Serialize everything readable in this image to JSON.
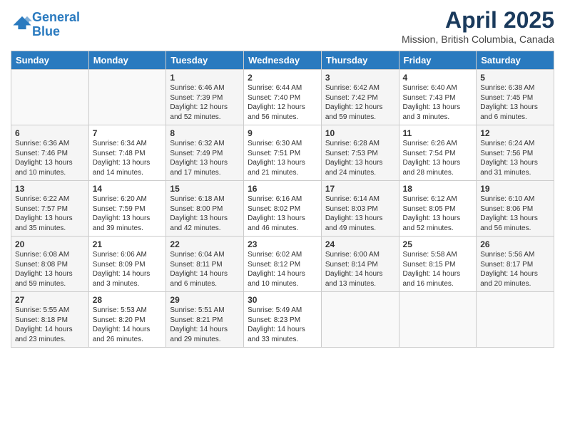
{
  "header": {
    "logo_line1": "General",
    "logo_line2": "Blue",
    "month_title": "April 2025",
    "subtitle": "Mission, British Columbia, Canada"
  },
  "weekdays": [
    "Sunday",
    "Monday",
    "Tuesday",
    "Wednesday",
    "Thursday",
    "Friday",
    "Saturday"
  ],
  "weeks": [
    [
      {
        "day": "",
        "sunrise": "",
        "sunset": "",
        "daylight": ""
      },
      {
        "day": "",
        "sunrise": "",
        "sunset": "",
        "daylight": ""
      },
      {
        "day": "1",
        "sunrise": "Sunrise: 6:46 AM",
        "sunset": "Sunset: 7:39 PM",
        "daylight": "Daylight: 12 hours and 52 minutes."
      },
      {
        "day": "2",
        "sunrise": "Sunrise: 6:44 AM",
        "sunset": "Sunset: 7:40 PM",
        "daylight": "Daylight: 12 hours and 56 minutes."
      },
      {
        "day": "3",
        "sunrise": "Sunrise: 6:42 AM",
        "sunset": "Sunset: 7:42 PM",
        "daylight": "Daylight: 12 hours and 59 minutes."
      },
      {
        "day": "4",
        "sunrise": "Sunrise: 6:40 AM",
        "sunset": "Sunset: 7:43 PM",
        "daylight": "Daylight: 13 hours and 3 minutes."
      },
      {
        "day": "5",
        "sunrise": "Sunrise: 6:38 AM",
        "sunset": "Sunset: 7:45 PM",
        "daylight": "Daylight: 13 hours and 6 minutes."
      }
    ],
    [
      {
        "day": "6",
        "sunrise": "Sunrise: 6:36 AM",
        "sunset": "Sunset: 7:46 PM",
        "daylight": "Daylight: 13 hours and 10 minutes."
      },
      {
        "day": "7",
        "sunrise": "Sunrise: 6:34 AM",
        "sunset": "Sunset: 7:48 PM",
        "daylight": "Daylight: 13 hours and 14 minutes."
      },
      {
        "day": "8",
        "sunrise": "Sunrise: 6:32 AM",
        "sunset": "Sunset: 7:49 PM",
        "daylight": "Daylight: 13 hours and 17 minutes."
      },
      {
        "day": "9",
        "sunrise": "Sunrise: 6:30 AM",
        "sunset": "Sunset: 7:51 PM",
        "daylight": "Daylight: 13 hours and 21 minutes."
      },
      {
        "day": "10",
        "sunrise": "Sunrise: 6:28 AM",
        "sunset": "Sunset: 7:53 PM",
        "daylight": "Daylight: 13 hours and 24 minutes."
      },
      {
        "day": "11",
        "sunrise": "Sunrise: 6:26 AM",
        "sunset": "Sunset: 7:54 PM",
        "daylight": "Daylight: 13 hours and 28 minutes."
      },
      {
        "day": "12",
        "sunrise": "Sunrise: 6:24 AM",
        "sunset": "Sunset: 7:56 PM",
        "daylight": "Daylight: 13 hours and 31 minutes."
      }
    ],
    [
      {
        "day": "13",
        "sunrise": "Sunrise: 6:22 AM",
        "sunset": "Sunset: 7:57 PM",
        "daylight": "Daylight: 13 hours and 35 minutes."
      },
      {
        "day": "14",
        "sunrise": "Sunrise: 6:20 AM",
        "sunset": "Sunset: 7:59 PM",
        "daylight": "Daylight: 13 hours and 39 minutes."
      },
      {
        "day": "15",
        "sunrise": "Sunrise: 6:18 AM",
        "sunset": "Sunset: 8:00 PM",
        "daylight": "Daylight: 13 hours and 42 minutes."
      },
      {
        "day": "16",
        "sunrise": "Sunrise: 6:16 AM",
        "sunset": "Sunset: 8:02 PM",
        "daylight": "Daylight: 13 hours and 46 minutes."
      },
      {
        "day": "17",
        "sunrise": "Sunrise: 6:14 AM",
        "sunset": "Sunset: 8:03 PM",
        "daylight": "Daylight: 13 hours and 49 minutes."
      },
      {
        "day": "18",
        "sunrise": "Sunrise: 6:12 AM",
        "sunset": "Sunset: 8:05 PM",
        "daylight": "Daylight: 13 hours and 52 minutes."
      },
      {
        "day": "19",
        "sunrise": "Sunrise: 6:10 AM",
        "sunset": "Sunset: 8:06 PM",
        "daylight": "Daylight: 13 hours and 56 minutes."
      }
    ],
    [
      {
        "day": "20",
        "sunrise": "Sunrise: 6:08 AM",
        "sunset": "Sunset: 8:08 PM",
        "daylight": "Daylight: 13 hours and 59 minutes."
      },
      {
        "day": "21",
        "sunrise": "Sunrise: 6:06 AM",
        "sunset": "Sunset: 8:09 PM",
        "daylight": "Daylight: 14 hours and 3 minutes."
      },
      {
        "day": "22",
        "sunrise": "Sunrise: 6:04 AM",
        "sunset": "Sunset: 8:11 PM",
        "daylight": "Daylight: 14 hours and 6 minutes."
      },
      {
        "day": "23",
        "sunrise": "Sunrise: 6:02 AM",
        "sunset": "Sunset: 8:12 PM",
        "daylight": "Daylight: 14 hours and 10 minutes."
      },
      {
        "day": "24",
        "sunrise": "Sunrise: 6:00 AM",
        "sunset": "Sunset: 8:14 PM",
        "daylight": "Daylight: 14 hours and 13 minutes."
      },
      {
        "day": "25",
        "sunrise": "Sunrise: 5:58 AM",
        "sunset": "Sunset: 8:15 PM",
        "daylight": "Daylight: 14 hours and 16 minutes."
      },
      {
        "day": "26",
        "sunrise": "Sunrise: 5:56 AM",
        "sunset": "Sunset: 8:17 PM",
        "daylight": "Daylight: 14 hours and 20 minutes."
      }
    ],
    [
      {
        "day": "27",
        "sunrise": "Sunrise: 5:55 AM",
        "sunset": "Sunset: 8:18 PM",
        "daylight": "Daylight: 14 hours and 23 minutes."
      },
      {
        "day": "28",
        "sunrise": "Sunrise: 5:53 AM",
        "sunset": "Sunset: 8:20 PM",
        "daylight": "Daylight: 14 hours and 26 minutes."
      },
      {
        "day": "29",
        "sunrise": "Sunrise: 5:51 AM",
        "sunset": "Sunset: 8:21 PM",
        "daylight": "Daylight: 14 hours and 29 minutes."
      },
      {
        "day": "30",
        "sunrise": "Sunrise: 5:49 AM",
        "sunset": "Sunset: 8:23 PM",
        "daylight": "Daylight: 14 hours and 33 minutes."
      },
      {
        "day": "",
        "sunrise": "",
        "sunset": "",
        "daylight": ""
      },
      {
        "day": "",
        "sunrise": "",
        "sunset": "",
        "daylight": ""
      },
      {
        "day": "",
        "sunrise": "",
        "sunset": "",
        "daylight": ""
      }
    ]
  ]
}
